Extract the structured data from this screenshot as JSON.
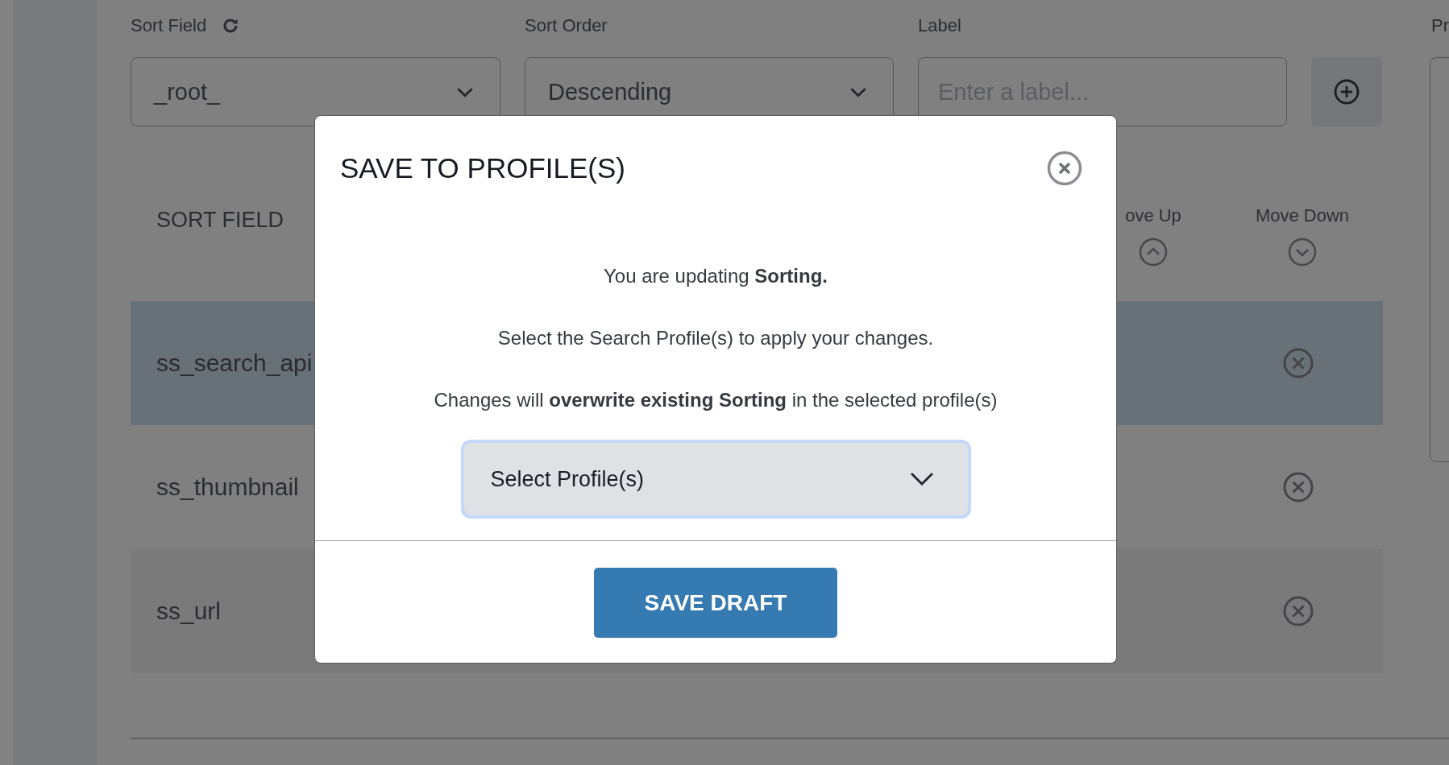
{
  "filters": [
    {
      "kind": "select",
      "label": "Sort Field",
      "value": "_root_"
    },
    {
      "kind": "select",
      "label": "Sort Order",
      "value": "Descending"
    },
    {
      "kind": "input",
      "label": "Label",
      "placeholder": "Enter a label..."
    }
  ],
  "side_panel": {
    "label": "Pr"
  },
  "table": {
    "columns": [
      "SORT FIELD",
      "ove Up",
      "Move Down"
    ],
    "rows": [
      {
        "field": "ss_search_api",
        "selected": true
      },
      {
        "field": "ss_thumbnail",
        "selected": false
      },
      {
        "field": "ss_url",
        "selected": false
      }
    ]
  },
  "modal": {
    "title": "SAVE TO PROFILE(S)",
    "paragraphs": [
      "You are updating **Sorting.**",
      "Select the Search Profile(s) to apply your changes.",
      "Changes will **overwrite existing Sorting** in the selected profile(s)"
    ],
    "profile_select": {
      "placeholder": "Select Profile(s)",
      "focused": true
    },
    "primary_button": "SAVE DRAFT"
  }
}
